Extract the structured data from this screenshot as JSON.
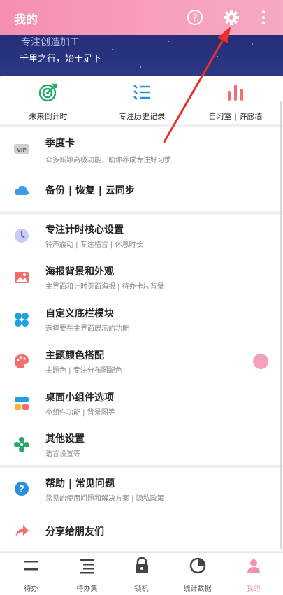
{
  "header": {
    "title": "我的",
    "motto_top": "专注创造加工",
    "motto": "千里之行，始于足下"
  },
  "quick": [
    {
      "label": "未来倒计时",
      "icon": "target-icon"
    },
    {
      "label": "专注历史记录",
      "icon": "history-list-icon"
    },
    {
      "label": "自习室 | 许愿墙",
      "icon": "bar-chart-icon"
    }
  ],
  "section1": [
    {
      "title": "季度卡",
      "sub": "众多新颖高级功能，助你养成专注好习惯",
      "icon": "vip-icon"
    },
    {
      "title": "备份 | 恢复 | 云同步",
      "sub": "",
      "icon": "cloud-icon"
    }
  ],
  "section2": [
    {
      "title": "专注计时核心设置",
      "sub": "铃声震动 | 专注格言 | 休息时长",
      "icon": "clock-icon"
    },
    {
      "title": "海报背景和外观",
      "sub": "主界面和计时页面海报 | 待办卡片背景",
      "icon": "image-icon"
    },
    {
      "title": "自定义底栏模块",
      "sub": "选择要在主界面展示的功能",
      "icon": "modules-icon"
    },
    {
      "title": "主题颜色搭配",
      "sub": "主题色 | 专注分布图配色",
      "icon": "palette-icon"
    },
    {
      "title": "桌面小组件选项",
      "sub": "小组件功能 | 背景图等",
      "icon": "widget-icon"
    },
    {
      "title": "其他设置",
      "sub": "语言设置等",
      "icon": "flower-settings-icon"
    }
  ],
  "section3": [
    {
      "title": "帮助 | 常见问题",
      "sub": "常见的使用问题和解决方案 | 隐私政策",
      "icon": "help-icon"
    },
    {
      "title": "分享给朋友们",
      "sub": "",
      "icon": "share-icon"
    }
  ],
  "nav": [
    {
      "label": "待办",
      "icon": "todo-icon"
    },
    {
      "label": "待办集",
      "icon": "todo-set-icon"
    },
    {
      "label": "锁机",
      "icon": "lock-icon"
    },
    {
      "label": "统计数据",
      "icon": "stats-icon"
    },
    {
      "label": "我的",
      "icon": "profile-icon"
    }
  ],
  "colors": {
    "accent_pink": "#f58fb0",
    "annotation_red": "#e8302a"
  }
}
